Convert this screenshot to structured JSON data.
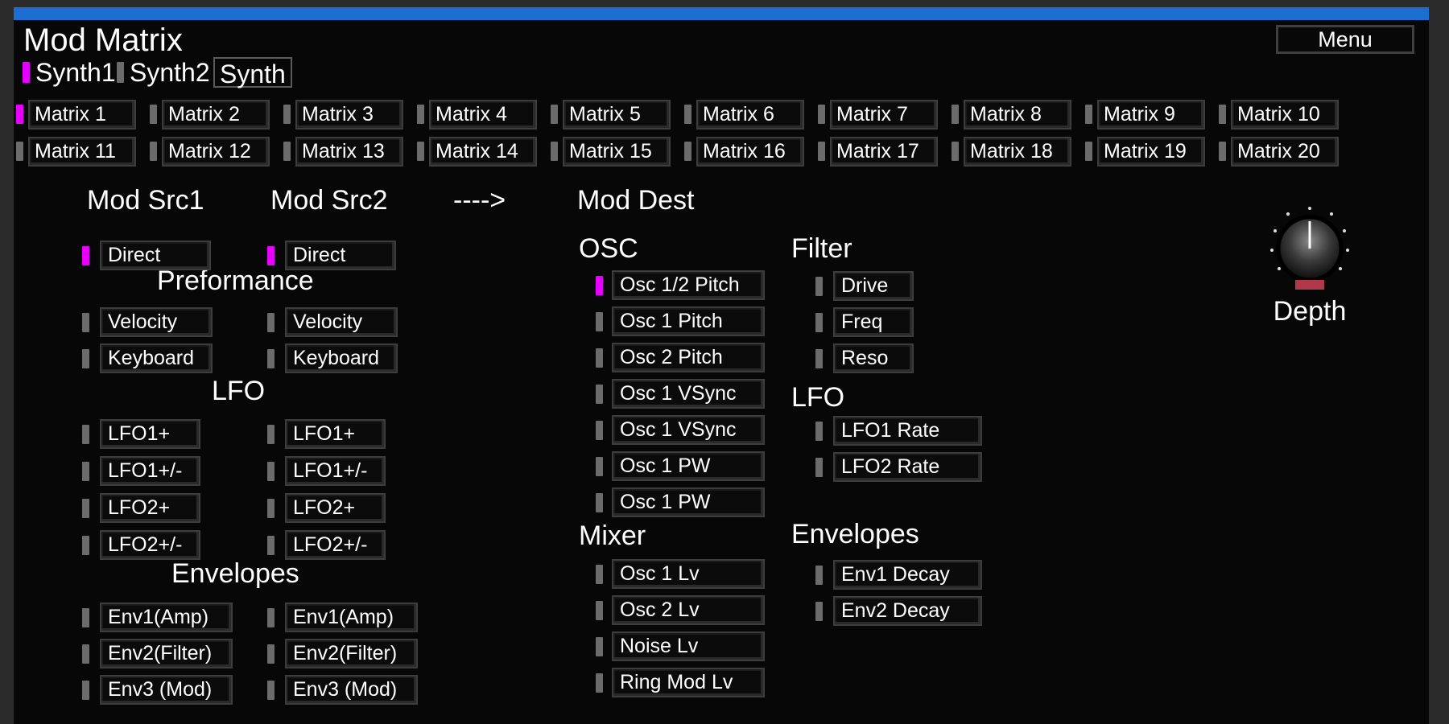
{
  "title": "Mod Matrix",
  "menu_label": "Menu",
  "synth_tabs": [
    "Synth1",
    "Synth2",
    "Synth"
  ],
  "matrix_slots": [
    "Matrix  1",
    "Matrix  2",
    "Matrix  3",
    "Matrix  4",
    "Matrix  5",
    "Matrix  6",
    "Matrix  7",
    "Matrix  8",
    "Matrix  9",
    "Matrix 10",
    "Matrix 11",
    "Matrix 12",
    "Matrix 13",
    "Matrix 14",
    "Matrix 15",
    "Matrix 16",
    "Matrix 17",
    "Matrix 18",
    "Matrix 19",
    "Matrix 20"
  ],
  "selected_matrix": "Matrix  1",
  "headers": {
    "src1": "Mod Src1",
    "src2": "Mod Src2",
    "arrow": "---->",
    "dest": "Mod Dest",
    "performance": "Preformance",
    "lfo": "LFO",
    "envelopes": "Envelopes",
    "osc": "OSC",
    "filter": "Filter",
    "dest_lfo": "LFO",
    "mixer": "Mixer",
    "dest_envelopes": "Envelopes"
  },
  "src1": {
    "direct": "Direct",
    "performance": [
      "Velocity",
      "Keyboard"
    ],
    "lfo": [
      "LFO1+",
      "LFO1+/-",
      "LFO2+",
      "LFO2+/-"
    ],
    "envelopes": [
      "Env1(Amp)",
      "Env2(Filter)",
      "Env3 (Mod)"
    ]
  },
  "src2": {
    "direct": "Direct",
    "performance": [
      "Velocity",
      "Keyboard"
    ],
    "lfo": [
      "LFO1+",
      "LFO1+/-",
      "LFO2+",
      "LFO2+/-"
    ],
    "envelopes": [
      "Env1(Amp)",
      "Env2(Filter)",
      "Env3 (Mod)"
    ]
  },
  "dest": {
    "osc": [
      "Osc 1/2 Pitch",
      "Osc 1 Pitch",
      "Osc 2 Pitch",
      "Osc 1 VSync",
      "Osc 1 VSync",
      "Osc 1 PW",
      "Osc 1 PW"
    ],
    "mixer": [
      "Osc 1 Lv",
      "Osc 2 Lv",
      "Noise Lv",
      "Ring Mod Lv"
    ],
    "filter": [
      "Drive",
      "Freq",
      "Reso"
    ],
    "lfo": [
      "LFO1 Rate",
      "LFO2 Rate"
    ],
    "envelopes": [
      "Env1 Decay",
      "Env2 Decay"
    ]
  },
  "active": {
    "synth": "Synth1",
    "src1": "Direct",
    "src2": "Direct",
    "dest": "Osc 1/2 Pitch"
  },
  "depth": {
    "label": "Depth",
    "knob_icon": "knob-icon",
    "indicator_color": "#b0384a"
  },
  "colors": {
    "accent_bar": "#1c6fd0",
    "active_indicator": "#e600ff",
    "inactive_indicator": "#6b6b6b"
  }
}
